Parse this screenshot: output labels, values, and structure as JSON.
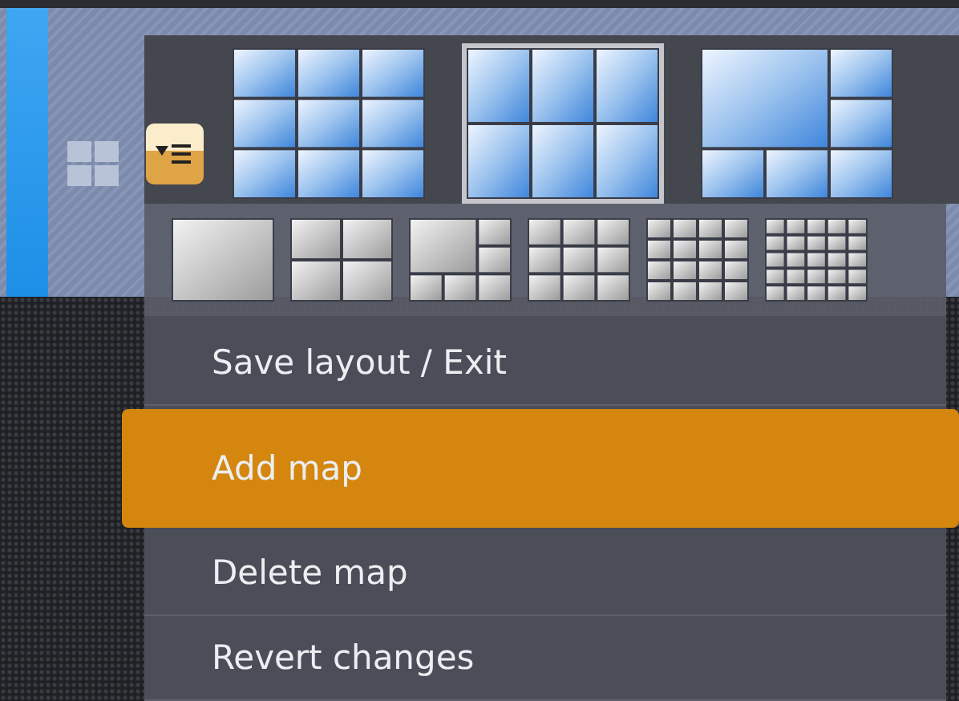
{
  "layouts": [
    {
      "kind": "nine",
      "selected": false
    },
    {
      "kind": "six",
      "selected": true
    },
    {
      "kind": "featured",
      "selected": false
    }
  ],
  "presets": [
    {
      "kind": "single"
    },
    {
      "kind": "quad"
    },
    {
      "kind": "featured"
    },
    {
      "kind": "nine"
    },
    {
      "kind": "sixteen"
    },
    {
      "kind": "twentyfive"
    }
  ],
  "menu": [
    {
      "label": "Save layout / Exit",
      "selected": false
    },
    {
      "label": "Add map",
      "selected": true
    },
    {
      "label": "Delete map",
      "selected": false
    },
    {
      "label": "Revert changes",
      "selected": false
    }
  ]
}
